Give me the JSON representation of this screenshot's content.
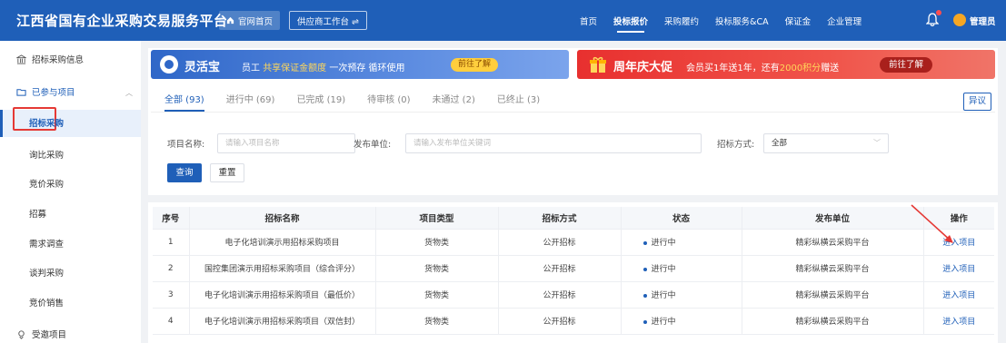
{
  "app": {
    "title": "江西省国有企业采购交易服务平台",
    "home_button": "官网首页",
    "workspace_button": "供应商工作台 ⇌",
    "nav": [
      "首页",
      "投标报价",
      "采购履约",
      "投标服务&CA",
      "保证金",
      "企业管理"
    ],
    "active_nav": "投标报价",
    "user": "管理员"
  },
  "sidebar": {
    "groups": [
      {
        "label": "招标采购信息"
      },
      {
        "label": "已参与项目"
      },
      {
        "label": "受邀项目"
      }
    ],
    "items": [
      "招标采购",
      "询比采购",
      "竞价采购",
      "招募",
      "需求调查",
      "谈判采购",
      "竞价销售"
    ],
    "active_item": "招标采购"
  },
  "banners": {
    "left": {
      "title": "灵活宝",
      "sub_prefix": "员工",
      "sub_highlight": "共享保证金额度",
      "sub_suffix": "一次预存 循环使用",
      "button": "前往了解"
    },
    "right": {
      "title": "周年庆大促",
      "sub_prefix": "会员买1年送1年，还有",
      "sub_highlight": "2000积分",
      "sub_suffix": "赠送",
      "button": "前往了解"
    }
  },
  "tabs": [
    "全部 (93)",
    "进行中 (69)",
    "已完成 (19)",
    "待审核 (0)",
    "未通过 (2)",
    "已终止 (3)"
  ],
  "objection_button": "异议",
  "filters": {
    "project_name_label": "项目名称:",
    "project_name_placeholder": "请输入项目名称",
    "publisher_label": "发布单位:",
    "publisher_placeholder": "请输入发布单位关键词",
    "method_label": "招标方式:",
    "method_value": "全部",
    "query_button": "查询",
    "reset_button": "重置"
  },
  "table": {
    "headers": [
      "序号",
      "招标名称",
      "项目类型",
      "招标方式",
      "状态",
      "发布单位",
      "操作"
    ],
    "rows": [
      [
        "1",
        "电子化培训演示用招标采购项目",
        "货物类",
        "公开招标",
        "进行中",
        "精彩纵横云采购平台",
        "进入项目"
      ],
      [
        "2",
        "国控集团演示用招标采购项目（综合评分）",
        "货物类",
        "公开招标",
        "进行中",
        "精彩纵横云采购平台",
        "进入项目"
      ],
      [
        "3",
        "电子化培训演示用招标采购项目（最低价）",
        "货物类",
        "公开招标",
        "进行中",
        "精彩纵横云采购平台",
        "进入项目"
      ],
      [
        "4",
        "电子化培训演示用招标采购项目（双信封）",
        "货物类",
        "公开招标",
        "进行中",
        "精彩纵横云采购平台",
        "进入项目"
      ]
    ]
  },
  "colors": {
    "primary": "#1f5fb8",
    "highlight_red": "#e53935"
  }
}
